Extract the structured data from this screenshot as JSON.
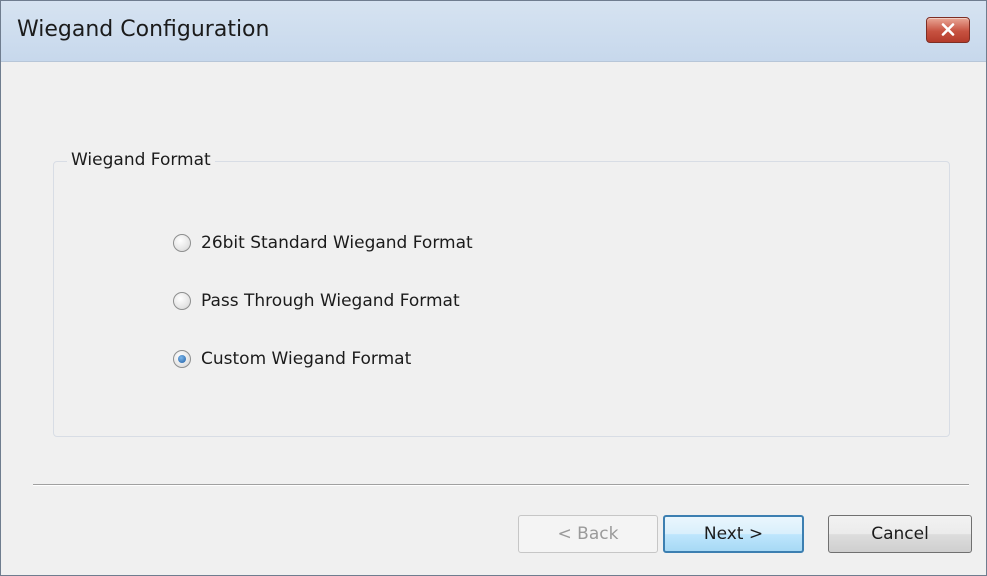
{
  "window": {
    "title": "Wiegand Configuration",
    "close_icon": "close-icon"
  },
  "group": {
    "legend": "Wiegand Format",
    "options": [
      {
        "label": "26bit Standard Wiegand Format",
        "checked": false
      },
      {
        "label": "Pass Through Wiegand Format",
        "checked": false
      },
      {
        "label": "Custom Wiegand Format",
        "checked": true
      }
    ]
  },
  "buttons": {
    "back": {
      "label": "< Back",
      "enabled": false
    },
    "next": {
      "label": "Next >",
      "enabled": true,
      "default": true
    },
    "cancel": {
      "label": "Cancel",
      "enabled": true
    }
  },
  "colors": {
    "titlebar": "#c7d8ec",
    "close_button": "#c75241",
    "radio_selected": "#1f5ea6",
    "default_button_border": "#3c7fb1"
  }
}
